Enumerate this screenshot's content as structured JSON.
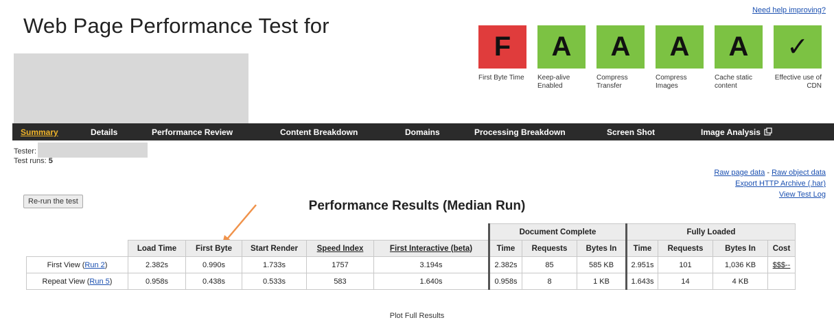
{
  "header": {
    "title": "Web Page Performance Test for",
    "help_link": "Need help improving?"
  },
  "grades": [
    {
      "grade": "F",
      "label": "First Byte Time",
      "color": "#e03c3c"
    },
    {
      "grade": "A",
      "label": "Keep-alive Enabled",
      "color": "#7cc243"
    },
    {
      "grade": "A",
      "label": "Compress Transfer",
      "color": "#7cc243"
    },
    {
      "grade": "A",
      "label": "Compress Images",
      "color": "#7cc243"
    },
    {
      "grade": "A",
      "label": "Cache static content",
      "color": "#7cc243"
    },
    {
      "grade": "✓",
      "label": "Effective use of CDN",
      "color": "#7cc243"
    }
  ],
  "nav": {
    "summary": "Summary",
    "details": "Details",
    "performance_review": "Performance Review",
    "content_breakdown": "Content Breakdown",
    "domains": "Domains",
    "processing_breakdown": "Processing Breakdown",
    "screen_shot": "Screen Shot",
    "image_analysis": "Image Analysis",
    "external_icon": "external-link-icon"
  },
  "info": {
    "tester_label": "Tester:",
    "test_runs_label": "Test runs:",
    "test_runs_value": "5",
    "rerun_button": "Re-run the test"
  },
  "links": {
    "raw_page_data": "Raw page data",
    "separator": "-",
    "raw_object_data": "Raw object data",
    "export_har": "Export HTTP Archive (.har)",
    "view_test_log": "View Test Log"
  },
  "results": {
    "title": "Performance Results (Median Run)",
    "group_document_complete": "Document Complete",
    "group_fully_loaded": "Fully Loaded",
    "columns": {
      "load_time": "Load Time",
      "first_byte": "First Byte",
      "start_render": "Start Render",
      "speed_index": "Speed Index",
      "first_interactive": "First Interactive (beta)",
      "dc_time": "Time",
      "dc_requests": "Requests",
      "dc_bytes_in": "Bytes In",
      "fl_time": "Time",
      "fl_requests": "Requests",
      "fl_bytes_in": "Bytes In",
      "cost": "Cost"
    },
    "rows": [
      {
        "label": "First View (",
        "run_link": "Run 2",
        "label_end": ")",
        "load_time": "2.382s",
        "first_byte": "0.990s",
        "start_render": "1.733s",
        "speed_index": "1757",
        "first_interactive": "3.194s",
        "dc_time": "2.382s",
        "dc_requests": "85",
        "dc_bytes_in": "585 KB",
        "fl_time": "2.951s",
        "fl_requests": "101",
        "fl_bytes_in": "1,036 KB",
        "cost": "$$$--"
      },
      {
        "label": "Repeat View (",
        "run_link": "Run 5",
        "label_end": ")",
        "load_time": "0.958s",
        "first_byte": "0.438s",
        "start_render": "0.533s",
        "speed_index": "583",
        "first_interactive": "1.640s",
        "dc_time": "0.958s",
        "dc_requests": "8",
        "dc_bytes_in": "1 KB",
        "fl_time": "1.643s",
        "fl_requests": "14",
        "fl_bytes_in": "4 KB",
        "cost": ""
      }
    ],
    "plot_link": "Plot Full Results"
  },
  "annotation": {
    "arrow_color": "#f0924a"
  }
}
